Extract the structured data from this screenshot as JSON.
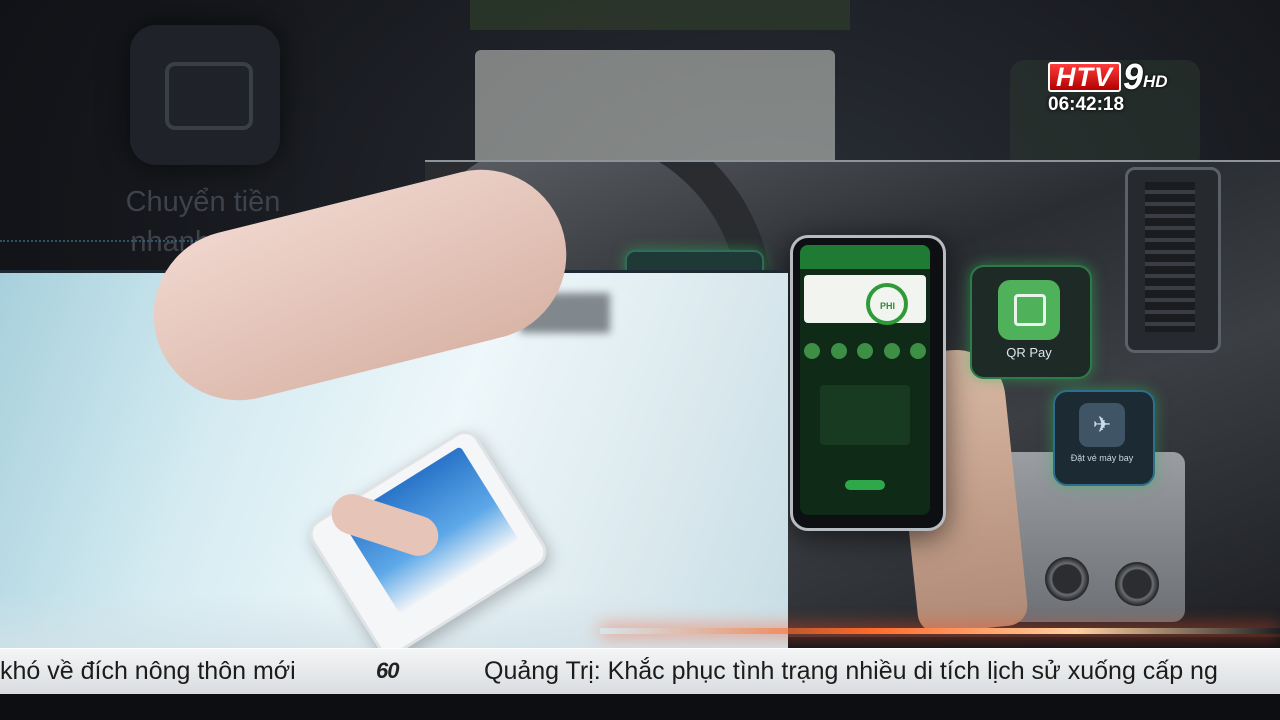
{
  "background": {
    "tile_caption_line1": "Chuyển tiền",
    "tile_caption_line2": "nhanh 24/7"
  },
  "app_screen": {
    "brand": "PHI",
    "tiles": [
      {
        "label": "QR Pay",
        "icon": "qr-code-icon"
      },
      {
        "label": "Đặt vé máy bay",
        "icon": "airplane-seat-icon"
      }
    ]
  },
  "channel": {
    "logo_letters": "HTV",
    "logo_number": "9",
    "logo_suffix": "HD",
    "clock": "06:42:18"
  },
  "ticker": {
    "left_text": "khó về đích nông thôn mới",
    "separator_logo": "60",
    "right_text": "Quảng Trị: Khắc phục tình trạng nhiều di tích lịch sử xuống cấp ng"
  },
  "colors": {
    "accent_green": "#4fb25a",
    "logo_red": "#d10000",
    "ticker_bg": "#e8eaec"
  }
}
